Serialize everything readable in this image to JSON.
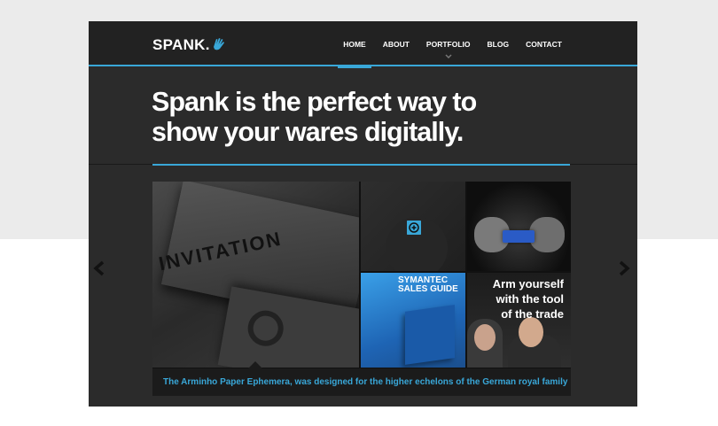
{
  "logo": {
    "text": "SPANK."
  },
  "nav": {
    "items": [
      {
        "label": "HOME",
        "active": true
      },
      {
        "label": "ABOUT",
        "active": false
      },
      {
        "label": "PORTFOLIO",
        "active": false
      },
      {
        "label": "BLOG",
        "active": false
      },
      {
        "label": "CONTACT",
        "active": false
      }
    ]
  },
  "hero": {
    "line1": "Spank is the perfect way to",
    "line2": "show your wares digitally."
  },
  "gallery": {
    "invitation_text": "INVITATION",
    "symantec_line1": "SYMANTEC",
    "symantec_line2": "SALES GUIDE",
    "arm_line1": "Arm yourself",
    "arm_line2": "with the tool",
    "arm_line3": "of the trade",
    "caption": "The Arminho Paper Ephemera, was designed for the higher echelons of the German royal family"
  },
  "colors": {
    "accent": "#39a7d8",
    "background": "#2b2b2b",
    "header": "#222222"
  },
  "icons": [
    "hand-icon",
    "chevron-down-icon",
    "zoom-plus-icon",
    "arrow-left-icon",
    "arrow-right-icon"
  ]
}
